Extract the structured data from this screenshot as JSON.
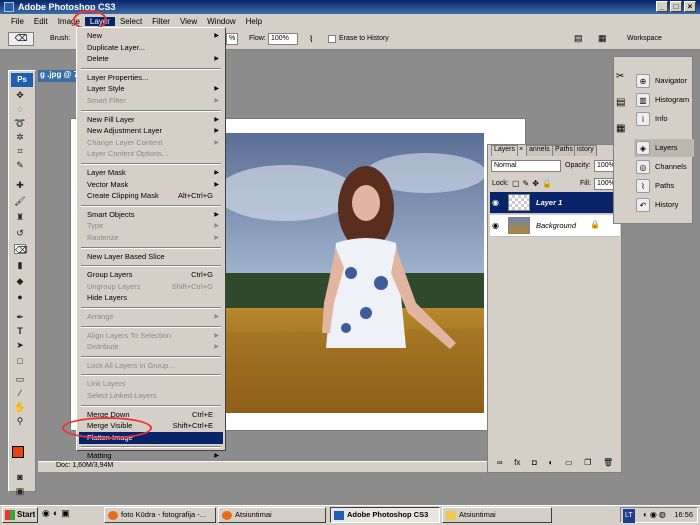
{
  "app": {
    "title": "Adobe Photoshop CS3"
  },
  "menubar": [
    "File",
    "Edit",
    "Image",
    "Layer",
    "Select",
    "Filter",
    "View",
    "Window",
    "Help"
  ],
  "options": {
    "brush_label": "Brush:",
    "flow_label": "Flow:",
    "flow_value": "100%",
    "erase_label": "Erase to History",
    "workspace": "Workspace"
  },
  "document": {
    "tab": "g .jpg @ 7",
    "status": "Doc: 1,60M/3,94M"
  },
  "layer_menu": [
    {
      "label": "New",
      "sub": true,
      "dis": false
    },
    {
      "label": "Duplicate Layer...",
      "dis": false
    },
    {
      "label": "Delete",
      "sub": true,
      "dis": false
    },
    {
      "sep": true
    },
    {
      "label": "Layer Properties...",
      "dis": false
    },
    {
      "label": "Layer Style",
      "sub": true,
      "dis": false
    },
    {
      "label": "Smart Filter",
      "sub": true,
      "dis": true
    },
    {
      "sep": true
    },
    {
      "label": "New Fill Layer",
      "sub": true,
      "dis": false
    },
    {
      "label": "New Adjustment Layer",
      "sub": true,
      "dis": false
    },
    {
      "label": "Change Layer Content",
      "sub": true,
      "dis": true
    },
    {
      "label": "Layer Content Options...",
      "dis": true
    },
    {
      "sep": true
    },
    {
      "label": "Layer Mask",
      "sub": true,
      "dis": false
    },
    {
      "label": "Vector Mask",
      "sub": true,
      "dis": false
    },
    {
      "label": "Create Clipping Mask",
      "sc": "Alt+Ctrl+G",
      "dis": false
    },
    {
      "sep": true
    },
    {
      "label": "Smart Objects",
      "sub": true,
      "dis": false
    },
    {
      "label": "Type",
      "sub": true,
      "dis": true
    },
    {
      "label": "Rasterize",
      "sub": true,
      "dis": true
    },
    {
      "sep": true
    },
    {
      "label": "New Layer Based Slice",
      "dis": false
    },
    {
      "sep": true
    },
    {
      "label": "Group Layers",
      "sc": "Ctrl+G",
      "dis": false
    },
    {
      "label": "Ungroup Layers",
      "sc": "Shift+Ctrl+G",
      "dis": true
    },
    {
      "label": "Hide Layers",
      "dis": false
    },
    {
      "sep": true
    },
    {
      "label": "Arrange",
      "sub": true,
      "dis": true
    },
    {
      "sep": true
    },
    {
      "label": "Align Layers To Selection",
      "sub": true,
      "dis": true
    },
    {
      "label": "Distribute",
      "sub": true,
      "dis": true
    },
    {
      "sep": true
    },
    {
      "label": "Lock All Layers in Group...",
      "dis": true
    },
    {
      "sep": true
    },
    {
      "label": "Link Layers",
      "dis": true
    },
    {
      "label": "Select Linked Layers",
      "dis": true
    },
    {
      "sep": true
    },
    {
      "label": "Merge Down",
      "sc": "Ctrl+E",
      "dis": false
    },
    {
      "label": "Merge Visible",
      "sc": "Shift+Ctrl+E",
      "dis": false
    },
    {
      "label": "Flatten Image",
      "dis": false,
      "sel": true
    },
    {
      "sep": true
    },
    {
      "label": "Matting",
      "sub": true,
      "dis": false
    }
  ],
  "layers_panel": {
    "tabs": [
      "Layers",
      "annels",
      "Paths",
      "istory"
    ],
    "blend": "Normal",
    "opacity_label": "Opacity:",
    "opacity": "100%",
    "lock_label": "Lock:",
    "fill_label": "Fill:",
    "fill": "100%",
    "layers": [
      {
        "name": "Layer 1",
        "selected": true
      },
      {
        "name": "Background",
        "selected": false
      }
    ]
  },
  "dock": {
    "group1": [
      "Navigator",
      "Histogram",
      "Info"
    ],
    "group2": [
      "Layers",
      "Channels",
      "Paths",
      "History"
    ]
  },
  "taskbar": {
    "start": "Start",
    "tasks": [
      "foto Kūdra - fotografija -...",
      "Atsiuntimai",
      "Adobe Photoshop CS3",
      "Atsiuntimai"
    ],
    "lang": "LT",
    "time": "16:56"
  }
}
